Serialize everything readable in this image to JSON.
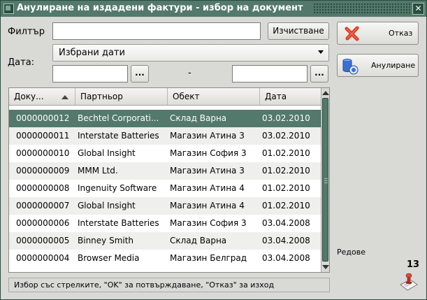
{
  "window": {
    "title": "Анулиране на издадени фактури - избор на документ",
    "close_glyph": "✕"
  },
  "filter": {
    "label": "Филтър",
    "value": "",
    "clear_label": "Изчистване"
  },
  "date": {
    "label": "Дата:",
    "mode": "Избрани дати",
    "from": "",
    "to": "",
    "separator": "-",
    "pick_label": "..."
  },
  "actions": {
    "cancel_label": "Отказ",
    "annul_label": "Анулиране"
  },
  "grid": {
    "columns": [
      "Доку...",
      "Партньор",
      "Обект",
      "Дата"
    ],
    "rows": [
      [
        "0000000012",
        "Bechtel Corporati...",
        "Склад Варна",
        "03.02.2010"
      ],
      [
        "0000000011",
        "Interstate Batteries",
        "Магазин Атина 3",
        "03.02.2010"
      ],
      [
        "0000000010",
        "Global Insight",
        "Магазин София 3",
        "01.02.2010"
      ],
      [
        "0000000009",
        "MMM Ltd.",
        "Магазин Атина 3",
        "01.02.2010"
      ],
      [
        "0000000008",
        "Ingenuity Software",
        "Магазин Атина 4",
        "01.02.2010"
      ],
      [
        "0000000007",
        "Global Insight",
        "Магазин Атина 4",
        "01.02.2010"
      ],
      [
        "0000000006",
        "Interstate Batteries",
        "Магазин София 3",
        "03.04.2008"
      ],
      [
        "0000000005",
        "Binney  Smith",
        "Склад Варна",
        "03.04.2008"
      ],
      [
        "0000000004",
        "Browser Media",
        "Магазин Белград",
        "03.04.2008"
      ]
    ],
    "selected_index": 0
  },
  "status_text": "Избор със стрелките, \"OK\" за потвърждаване, \"Отказ\" за изход",
  "rows_panel": {
    "label": "Редове",
    "count": "13"
  },
  "colors": {
    "accent": "#52796b",
    "window_bg": "#d9d9d6",
    "cancel_x": "#e0321c",
    "annul_icon": "#3b6fd1"
  },
  "icons": {
    "cancel": "red-x-icon",
    "annul": "blue-cylinder-icon",
    "print": "stamp-icon"
  }
}
